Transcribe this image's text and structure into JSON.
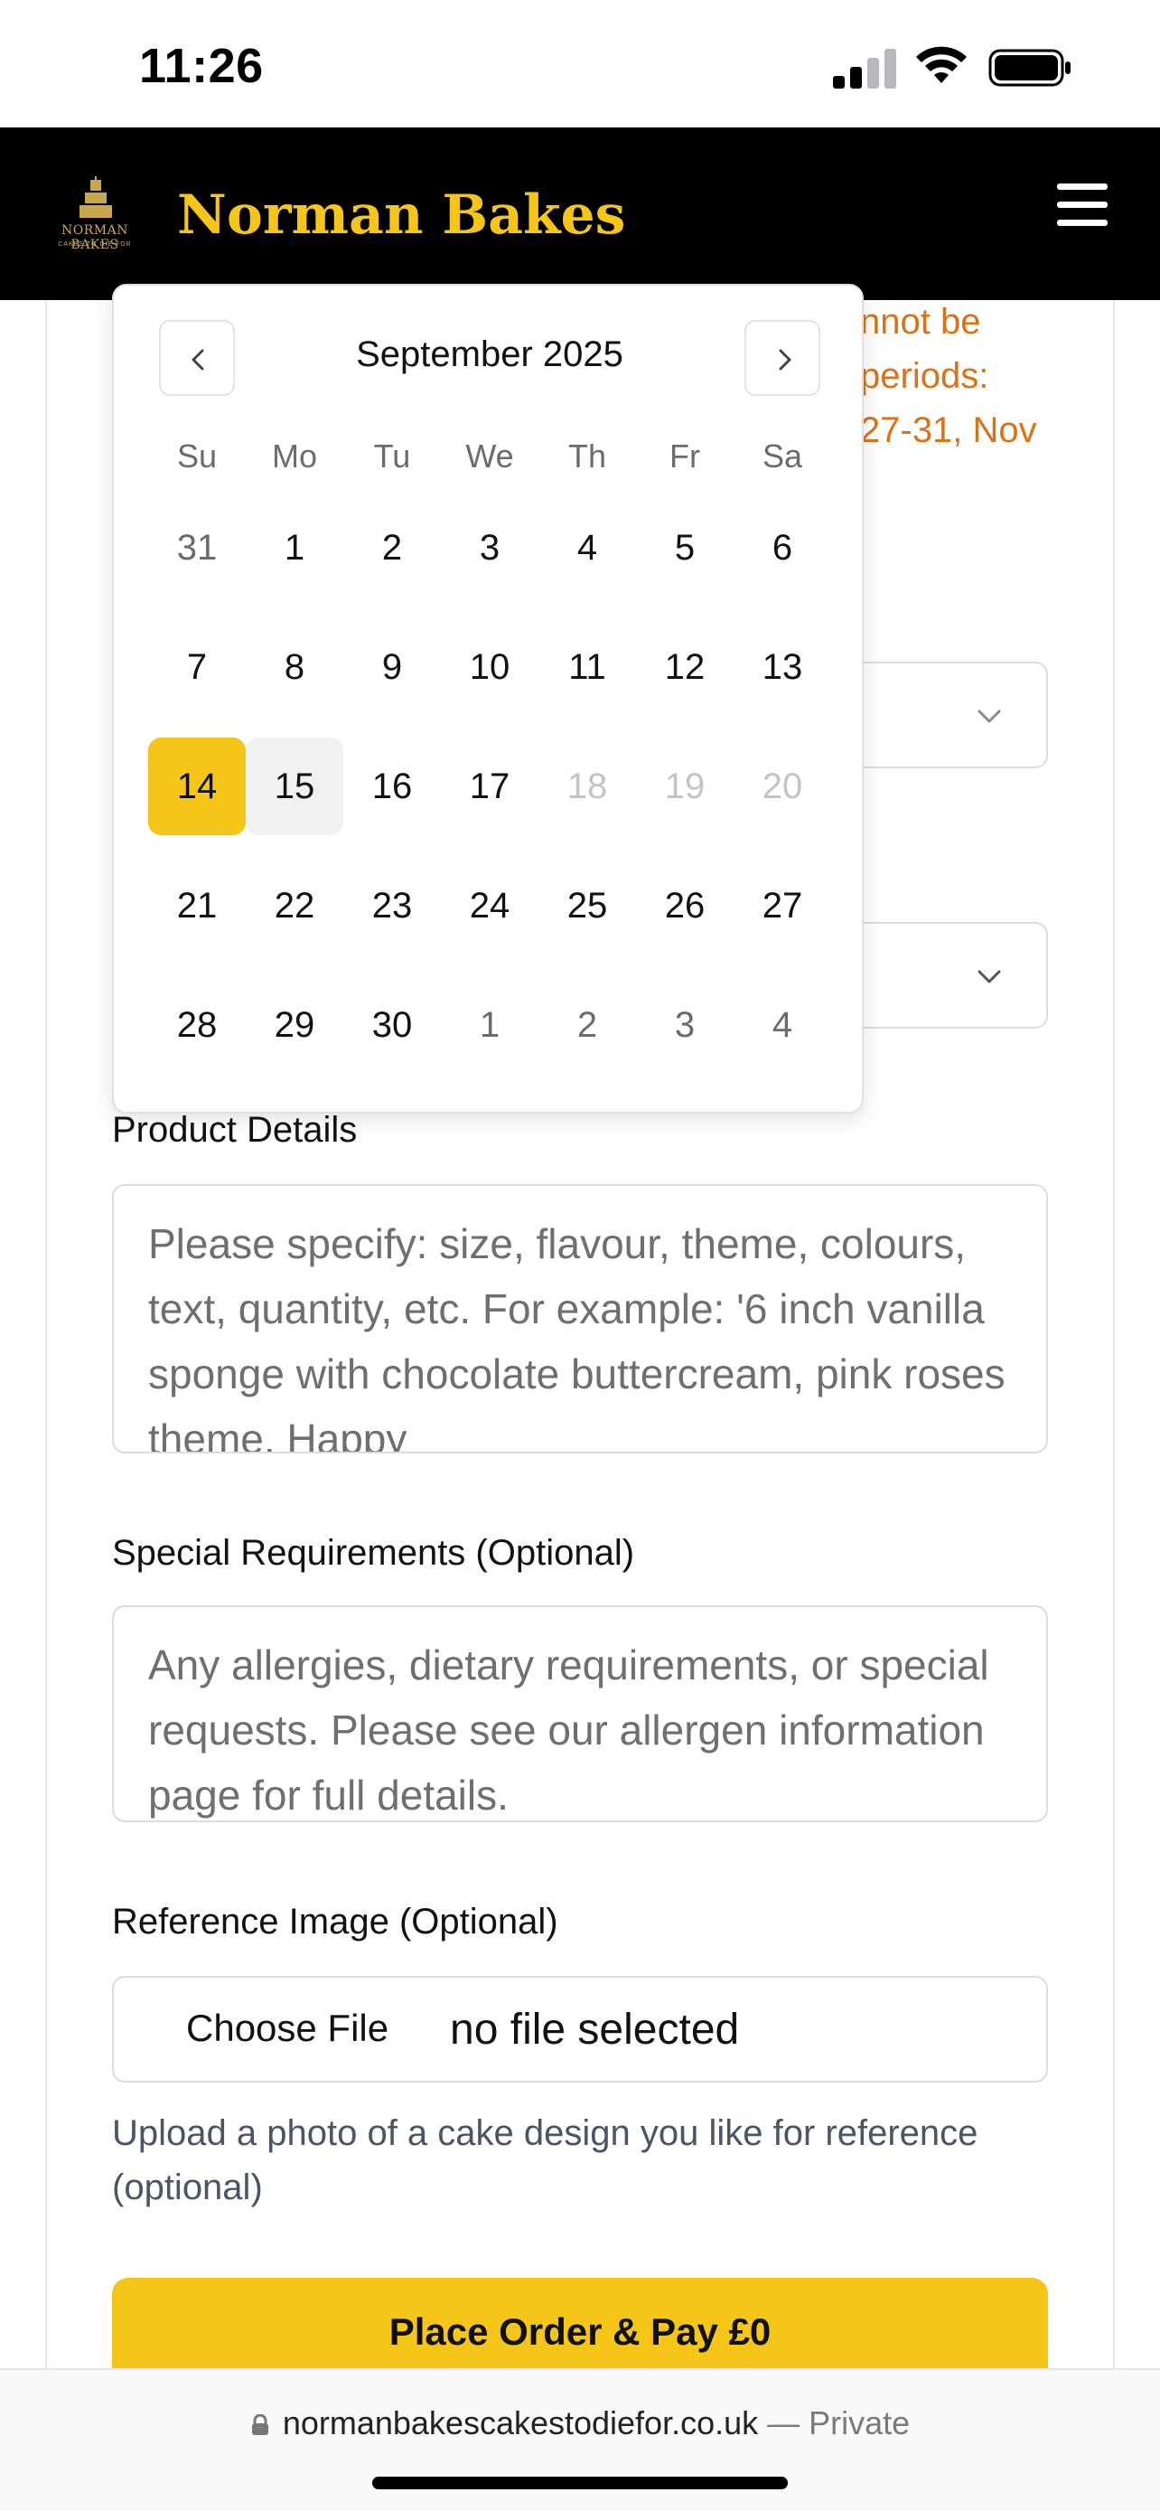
{
  "status_bar": {
    "time": "11:26"
  },
  "navbar": {
    "logo_text": "NORMAN BAKES",
    "logo_subtext": "CAKES TO DIE FOR",
    "brand": "Norman Bakes",
    "menu_icon": "hamburger-icon"
  },
  "notice": {
    "lines": [
      "nnot be",
      "periods:",
      "27-31, Nov"
    ],
    "color": "#d9731a"
  },
  "datepicker": {
    "month_label": "September 2025",
    "prev_icon": "chevron-left-icon",
    "next_icon": "chevron-right-icon",
    "weekdays": [
      "Su",
      "Mo",
      "Tu",
      "We",
      "Th",
      "Fr",
      "Sa"
    ],
    "weeks": [
      [
        {
          "d": "31",
          "s": "muted"
        },
        {
          "d": "1",
          "s": ""
        },
        {
          "d": "2",
          "s": ""
        },
        {
          "d": "3",
          "s": ""
        },
        {
          "d": "4",
          "s": ""
        },
        {
          "d": "5",
          "s": ""
        },
        {
          "d": "6",
          "s": ""
        }
      ],
      [
        {
          "d": "7",
          "s": ""
        },
        {
          "d": "8",
          "s": ""
        },
        {
          "d": "9",
          "s": ""
        },
        {
          "d": "10",
          "s": ""
        },
        {
          "d": "11",
          "s": ""
        },
        {
          "d": "12",
          "s": ""
        },
        {
          "d": "13",
          "s": ""
        }
      ],
      [
        {
          "d": "14",
          "s": "selected"
        },
        {
          "d": "15",
          "s": "hover"
        },
        {
          "d": "16",
          "s": ""
        },
        {
          "d": "17",
          "s": ""
        },
        {
          "d": "18",
          "s": "disabled"
        },
        {
          "d": "19",
          "s": "disabled"
        },
        {
          "d": "20",
          "s": "disabled"
        }
      ],
      [
        {
          "d": "21",
          "s": ""
        },
        {
          "d": "22",
          "s": ""
        },
        {
          "d": "23",
          "s": ""
        },
        {
          "d": "24",
          "s": ""
        },
        {
          "d": "25",
          "s": ""
        },
        {
          "d": "26",
          "s": ""
        },
        {
          "d": "27",
          "s": ""
        }
      ],
      [
        {
          "d": "28",
          "s": ""
        },
        {
          "d": "29",
          "s": ""
        },
        {
          "d": "30",
          "s": ""
        },
        {
          "d": "1",
          "s": "muted"
        },
        {
          "d": "2",
          "s": "muted"
        },
        {
          "d": "3",
          "s": "muted"
        },
        {
          "d": "4",
          "s": "muted"
        }
      ]
    ],
    "selected_color": "#f5c518"
  },
  "form": {
    "product_details_label": "Product Details",
    "product_details_placeholder": "Please specify: size, flavour, theme, colours, text, quantity, etc. For example: '6 inch vanilla sponge with chocolate buttercream, pink roses theme, Happy",
    "special_requirements_label": "Special Requirements (Optional)",
    "special_requirements_placeholder": "Any allergies, dietary requirements, or special requests. Please see our allergen information page for full details.",
    "reference_image_label": "Reference Image (Optional)",
    "choose_file_label": "Choose File",
    "no_file_text": "no file selected",
    "reference_help": "Upload a photo of a cake design you like for reference (optional)",
    "submit_label": "Place Order & Pay £0",
    "accent_color": "#f5c518"
  },
  "browser": {
    "url": "normanbakescakestodiefor.co.uk",
    "privacy": "— Private"
  }
}
